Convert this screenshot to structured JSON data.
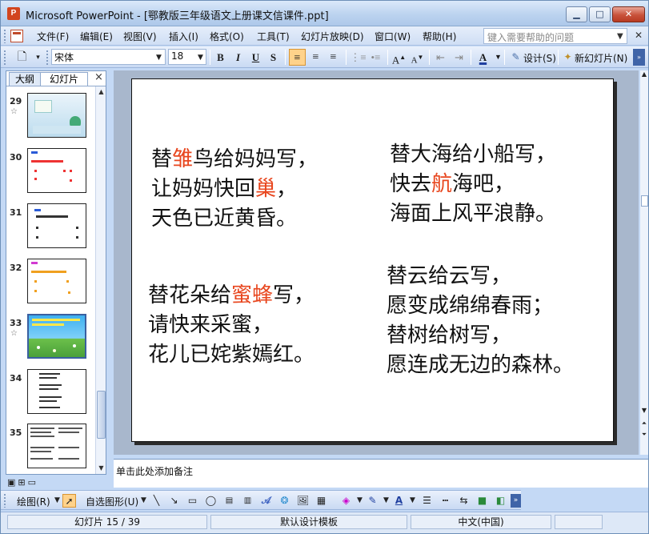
{
  "window": {
    "title": "Microsoft PowerPoint - [鄂教版三年级语文上册课文信课件.ppt]",
    "app_icon_letter": "P",
    "min_symbol": "▁",
    "max_symbol": "□",
    "close_symbol": "✕"
  },
  "menu": {
    "items": [
      "文件(F)",
      "编辑(E)",
      "视图(V)",
      "插入(I)",
      "格式(O)",
      "工具(T)",
      "幻灯片放映(D)",
      "窗口(W)",
      "帮助(H)"
    ],
    "help_placeholder": "键入需要帮助的问题",
    "close_symbol": "✕"
  },
  "toolbar": {
    "font_name": "宋体",
    "font_size": "18",
    "bold": "B",
    "italic": "I",
    "underline": "U",
    "shadow": "S",
    "design_label": "设计(S)",
    "new_slide_label": "新幻灯片(N)"
  },
  "left_pane": {
    "tabs": [
      "大纲",
      "幻灯片"
    ],
    "close_symbol": "×",
    "slides": [
      {
        "number": "29",
        "has_star": true
      },
      {
        "number": "30",
        "has_star": false
      },
      {
        "number": "31",
        "has_star": false
      },
      {
        "number": "32",
        "has_star": false
      },
      {
        "number": "33",
        "has_star": true
      },
      {
        "number": "34",
        "has_star": false
      },
      {
        "number": "35",
        "has_star": false
      }
    ],
    "star_symbol": "☆"
  },
  "slide": {
    "stanzas": [
      {
        "lines": [
          [
            {
              "t": "替",
              "red": false
            },
            {
              "t": "雏",
              "red": true
            },
            {
              "t": "鸟给妈妈写，",
              "red": false
            }
          ],
          [
            {
              "t": "让妈妈快回",
              "red": false
            },
            {
              "t": "巢",
              "red": true
            },
            {
              "t": "，",
              "red": false
            }
          ],
          [
            {
              "t": "天色已近黄昏。",
              "red": false
            }
          ]
        ]
      },
      {
        "lines": [
          [
            {
              "t": "替大海给小船写，",
              "red": false
            }
          ],
          [
            {
              "t": "快去",
              "red": false
            },
            {
              "t": "航",
              "red": true
            },
            {
              "t": "海吧，",
              "red": false
            }
          ],
          [
            {
              "t": "海面上风平浪静。",
              "red": false
            }
          ]
        ]
      },
      {
        "lines": [
          [
            {
              "t": "替花朵给",
              "red": false
            },
            {
              "t": "蜜蜂",
              "red": true
            },
            {
              "t": "写，",
              "red": false
            }
          ],
          [
            {
              "t": "请快来采蜜，",
              "red": false
            }
          ],
          [
            {
              "t": "花儿已姹紫嫣红。",
              "red": false
            }
          ]
        ]
      },
      {
        "lines": [
          [
            {
              "t": "替云给云写，",
              "red": false
            }
          ],
          [
            {
              "t": "愿变成绵绵春雨；",
              "red": false
            }
          ],
          [
            {
              "t": "替树给树写，",
              "red": false
            }
          ],
          [
            {
              "t": "愿连成无边的森林。",
              "red": false
            }
          ]
        ]
      }
    ],
    "red_color": "#e8461e"
  },
  "notes": {
    "placeholder": "单击此处添加备注"
  },
  "draw_toolbar": {
    "draw_label": "绘图(R)",
    "autoshapes_label": "自选图形(U)"
  },
  "status": {
    "slide_indicator": "幻灯片 15 / 39",
    "template": "默认设计模板",
    "language": "中文(中国)"
  }
}
